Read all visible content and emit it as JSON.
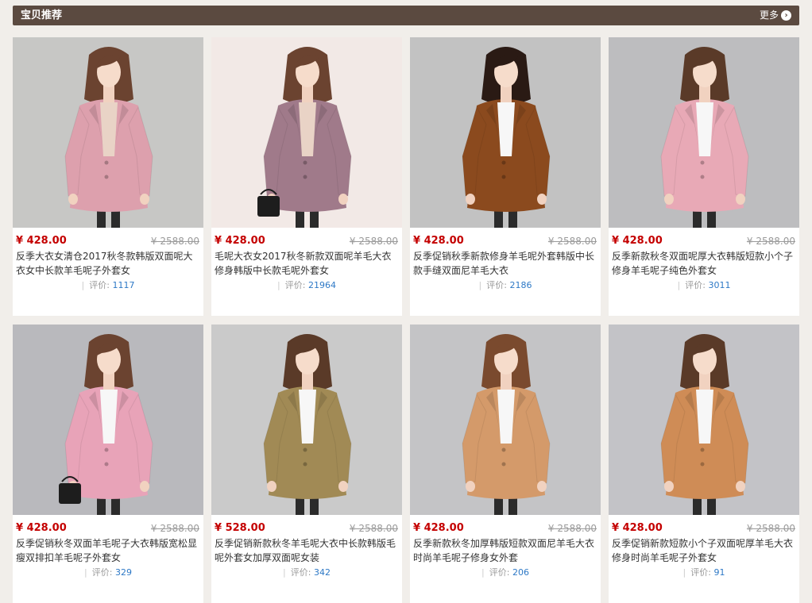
{
  "section": {
    "title": "宝贝推荐",
    "more_label": "更多",
    "more_icon": "chevron-right-circle-icon"
  },
  "colors": {
    "header_bg": "#5b4a40",
    "price": "#c40000",
    "review_count": "#2e79c6",
    "page_bg": "#f1eeea"
  },
  "products": [
    {
      "price": "¥ 428.00",
      "orig_price": "¥ 2588.00",
      "title": "反季大衣女清仓2017秋冬款韩版双面呢大衣女中长款羊毛呢子外套女",
      "review_label": "评价:",
      "review_count": "1117",
      "coat_color": "#dda0ad",
      "bg_color": "#c7c7c5",
      "inner_color": "#e9d3c6",
      "hair_color": "#6b4330",
      "accessory": "none"
    },
    {
      "price": "¥ 428.00",
      "orig_price": "¥ 2588.00",
      "title": "毛呢大衣女2017秋冬新款双面呢羊毛大衣修身韩版中长款毛呢外套女",
      "review_label": "评价:",
      "review_count": "21964",
      "coat_color": "#a07a8a",
      "bg_color": "#f2e9e6",
      "inner_color": "#e9d3c6",
      "hair_color": "#6b4330",
      "accessory": "handbag"
    },
    {
      "price": "¥ 428.00",
      "orig_price": "¥ 2588.00",
      "title": "反季促销秋季新款修身羊毛呢外套韩版中长款手缝双面尼羊毛大衣",
      "review_label": "评价:",
      "review_count": "2186",
      "coat_color": "#8b4a1e",
      "bg_color": "#c2c2c2",
      "inner_color": "#f7f7f7",
      "hair_color": "#2a1a14",
      "accessory": "none"
    },
    {
      "price": "¥ 428.00",
      "orig_price": "¥ 2588.00",
      "title": "反季新款秋冬双面呢厚大衣韩版短款小个子修身羊毛呢子纯色外套女",
      "review_label": "评价:",
      "review_count": "3011",
      "coat_color": "#e8a9b6",
      "bg_color": "#bdbdbf",
      "inner_color": "#f7f7f7",
      "hair_color": "#5a3a28",
      "accessory": "none"
    },
    {
      "price": "¥ 428.00",
      "orig_price": "¥ 2588.00",
      "title": "反季促销秋冬双面羊毛呢子大衣韩版宽松显瘦双排扣羊毛呢子外套女",
      "review_label": "评价:",
      "review_count": "329",
      "coat_color": "#e8a3b8",
      "bg_color": "#b9b9bd",
      "inner_color": "#f7f7f7",
      "hair_color": "#6b4330",
      "accessory": "bag"
    },
    {
      "price": "¥ 528.00",
      "orig_price": "¥ 2588.00",
      "title": "反季促销新款秋冬羊毛呢大衣中长款韩版毛呢外套女加厚双面呢女装",
      "review_label": "评价:",
      "review_count": "342",
      "coat_color": "#a18a55",
      "bg_color": "#cacaca",
      "inner_color": "#f7f7f7",
      "hair_color": "#5a3a28",
      "accessory": "none"
    },
    {
      "price": "¥ 428.00",
      "orig_price": "¥ 2588.00",
      "title": "反季新款秋冬加厚韩版短款双面尼羊毛大衣时尚羊毛呢子修身女外套",
      "review_label": "评价:",
      "review_count": "206",
      "coat_color": "#d49a6a",
      "bg_color": "#c4c4c6",
      "inner_color": "#f7f7f7",
      "hair_color": "#7a4a2e",
      "accessory": "none"
    },
    {
      "price": "¥ 428.00",
      "orig_price": "¥ 2588.00",
      "title": "反季促销新款短款小个子双面呢厚羊毛大衣修身时尚羊毛呢子外套女",
      "review_label": "评价:",
      "review_count": "91",
      "coat_color": "#cf8c56",
      "bg_color": "#c3c3c7",
      "inner_color": "#f7f7f7",
      "hair_color": "#5a3a28",
      "accessory": "none"
    }
  ]
}
